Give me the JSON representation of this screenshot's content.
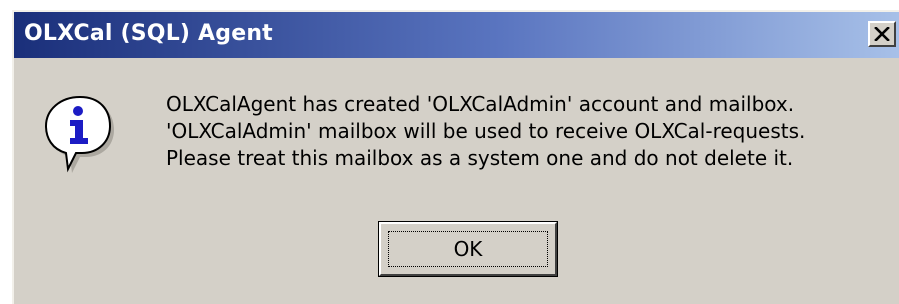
{
  "window": {
    "title": "OLXCal (SQL) Agent",
    "close_glyph": "X"
  },
  "icon": {
    "name": "information-icon",
    "glyph": "i",
    "color": "#1c1cc4"
  },
  "message": {
    "lines": [
      "OLXCalAgent has created 'OLXCalAdmin' account and mailbox.",
      "'OLXCalAdmin' mailbox will be used to receive OLXCal-requests.",
      "Please treat this mailbox as a system one and do not delete it."
    ]
  },
  "buttons": {
    "ok_label": "OK"
  },
  "colors": {
    "dialog_face": "#d4d0c8",
    "title_gradient_start": "#1a2f7a",
    "title_gradient_end": "#a7c0e8",
    "title_text": "#ffffff"
  }
}
